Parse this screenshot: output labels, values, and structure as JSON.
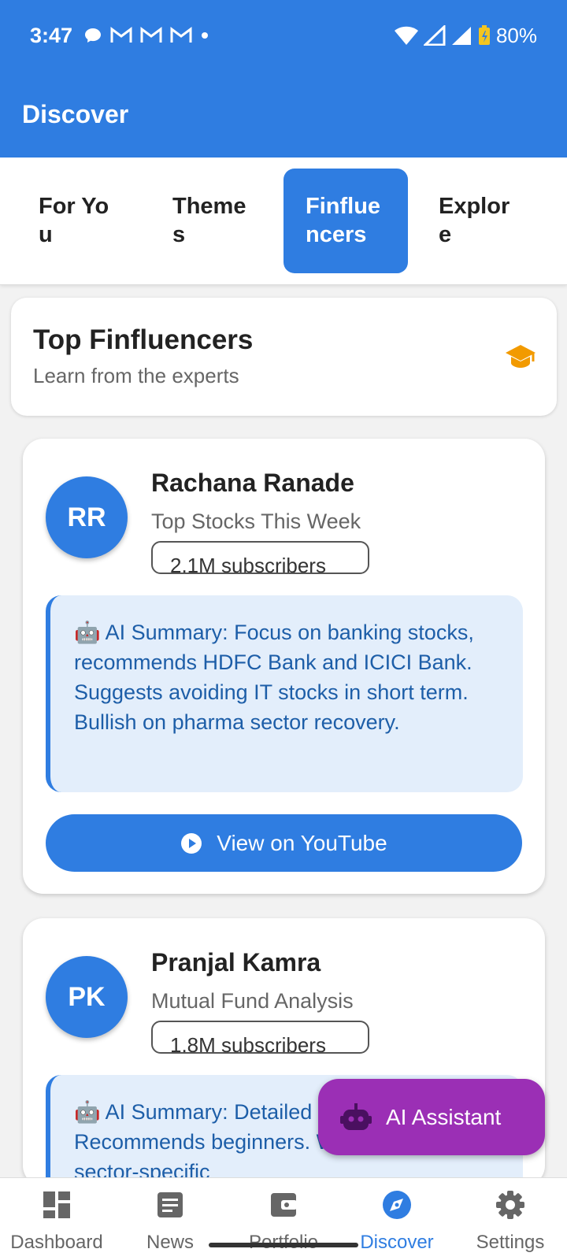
{
  "status_bar": {
    "time": "3:47",
    "notification_icons": [
      "chat-icon",
      "gmail-icon",
      "gmail-icon",
      "gmail-icon",
      "dot-icon"
    ],
    "battery": "80%"
  },
  "app_bar": {
    "title": "Discover"
  },
  "tabs": [
    {
      "label": "For You"
    },
    {
      "label": "Themes"
    },
    {
      "label": "Finfluencers"
    },
    {
      "label": "Explore"
    }
  ],
  "header": {
    "title": "Top Finfluencers",
    "subtitle": "Learn from the experts",
    "icon": "graduation-cap-icon",
    "icon_color": "#f29a00"
  },
  "finfluencers": [
    {
      "initials": "RR",
      "name": "Rachana Ranade",
      "topic": "Top Stocks This Week",
      "subscribers": "2.1M subscribers",
      "summary": "🤖 AI Summary: Focus on banking stocks, recommends HDFC Bank and ICICI Bank. Suggests avoiding IT stocks in short term. Bullish on pharma sector recovery.",
      "button": "View on YouTube"
    },
    {
      "initials": "PK",
      "name": "Pranjal Kamra",
      "topic": "Mutual Fund Analysis",
      "subscribers": "1.8M subscribers",
      "summary": "🤖 AI Summary: Detailed strategies. Recommends beginners. Warns against sector-specific"
    }
  ],
  "fab": {
    "label": "AI Assistant",
    "icon": "robot-icon"
  },
  "bottom_nav": [
    {
      "label": "Dashboard",
      "icon": "dashboard-icon"
    },
    {
      "label": "News",
      "icon": "news-icon"
    },
    {
      "label": "Portfolio",
      "icon": "wallet-icon"
    },
    {
      "label": "Discover",
      "icon": "compass-icon",
      "active": true
    },
    {
      "label": "Settings",
      "icon": "gear-icon"
    }
  ],
  "colors": {
    "primary": "#2f7de1",
    "accent": "#9b2fb5",
    "summary_bg": "#e3eefb",
    "summary_text": "#1d5ea8"
  }
}
